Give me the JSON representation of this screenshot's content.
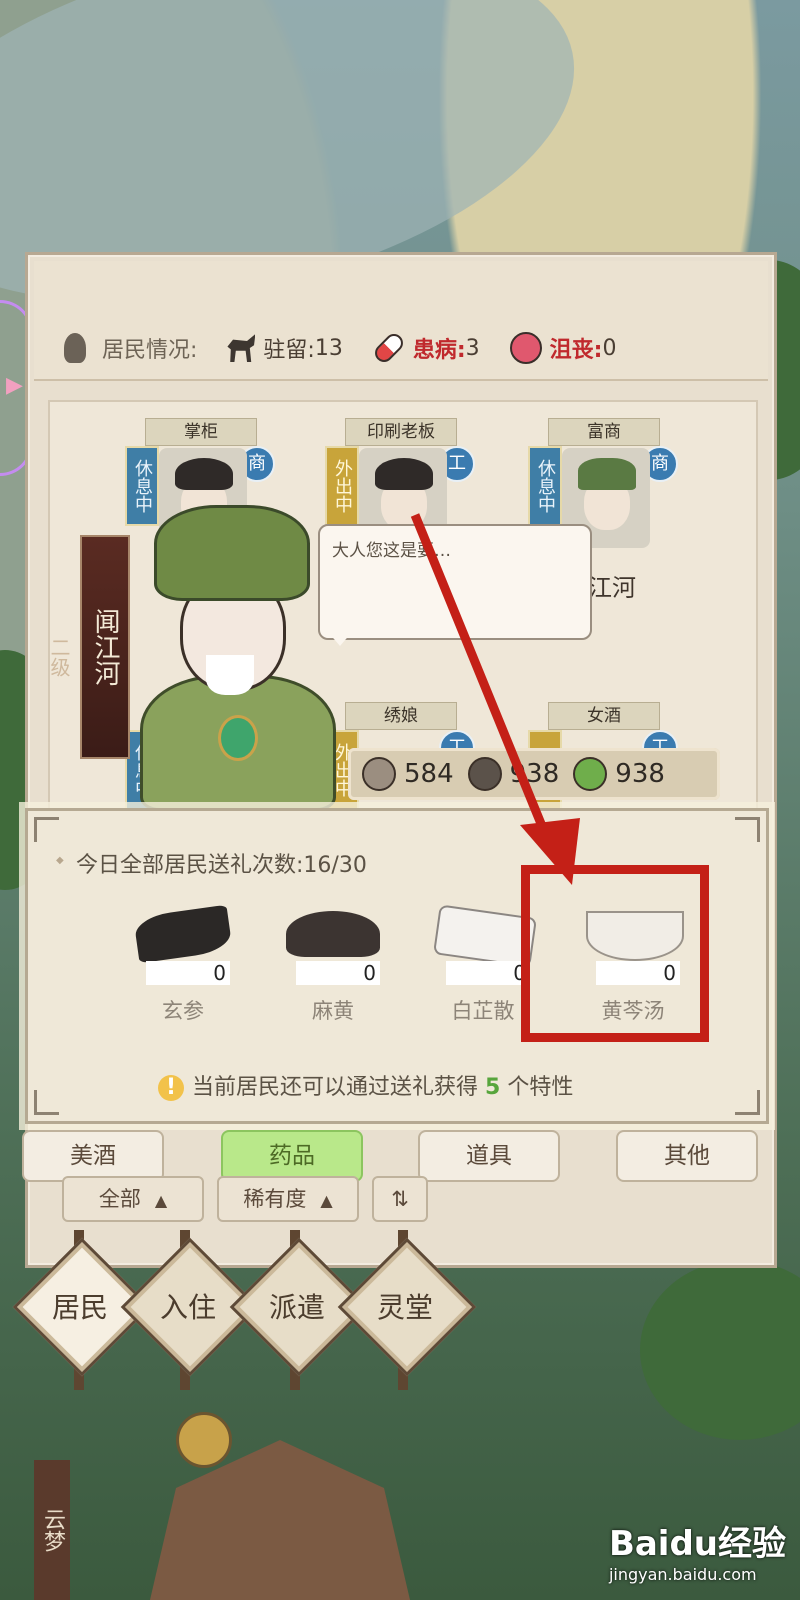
{
  "status": {
    "title": "居民情况:",
    "stationed": {
      "label": "驻留:",
      "value": "13"
    },
    "sick": {
      "label": "患病:",
      "value": "3"
    },
    "depressed": {
      "label": "沮丧:",
      "value": "0"
    }
  },
  "residents": [
    {
      "title": "掌柜",
      "state": "休息中",
      "role": "商",
      "name": ""
    },
    {
      "title": "印刷老板",
      "state": "外出中",
      "role": "工",
      "name": ""
    },
    {
      "title": "富商",
      "state": "休息中",
      "role": "商",
      "name": "江河"
    },
    {
      "title": "绣娘",
      "state": "外出中",
      "role": "工",
      "name": ""
    },
    {
      "title": "女酒",
      "state": "外",
      "role": "工",
      "name": ""
    }
  ],
  "selected_resident": {
    "name": "闻江河",
    "level": "二级"
  },
  "speech": "大人您这是要…",
  "resources": [
    "584",
    "938",
    "938"
  ],
  "gift": {
    "count_label": "今日全部居民送礼次数:16/30",
    "items": [
      {
        "name": "玄参",
        "count": "0"
      },
      {
        "name": "麻黄",
        "count": "0"
      },
      {
        "name": "白芷散",
        "count": "0"
      },
      {
        "name": "黄芩汤",
        "count": "0"
      }
    ],
    "note_prefix": "当前居民还可以通过送礼获得",
    "note_number": "5",
    "note_suffix": "个特性"
  },
  "tabs": [
    "美酒",
    "药品",
    "道具",
    "其他"
  ],
  "active_tab": "药品",
  "filters": {
    "all": "全部",
    "rarity": "稀有度",
    "sort_icon": "sort-icon"
  },
  "nav": [
    "居民",
    "入住",
    "派遣",
    "灵堂"
  ],
  "location_plate": "云梦",
  "watermark": {
    "brand": "Baidu经验",
    "url": "jingyan.baidu.com"
  },
  "colors": {
    "highlight": "#c42017",
    "active_tab": "#b9e88a",
    "warning": "#c0292d"
  }
}
